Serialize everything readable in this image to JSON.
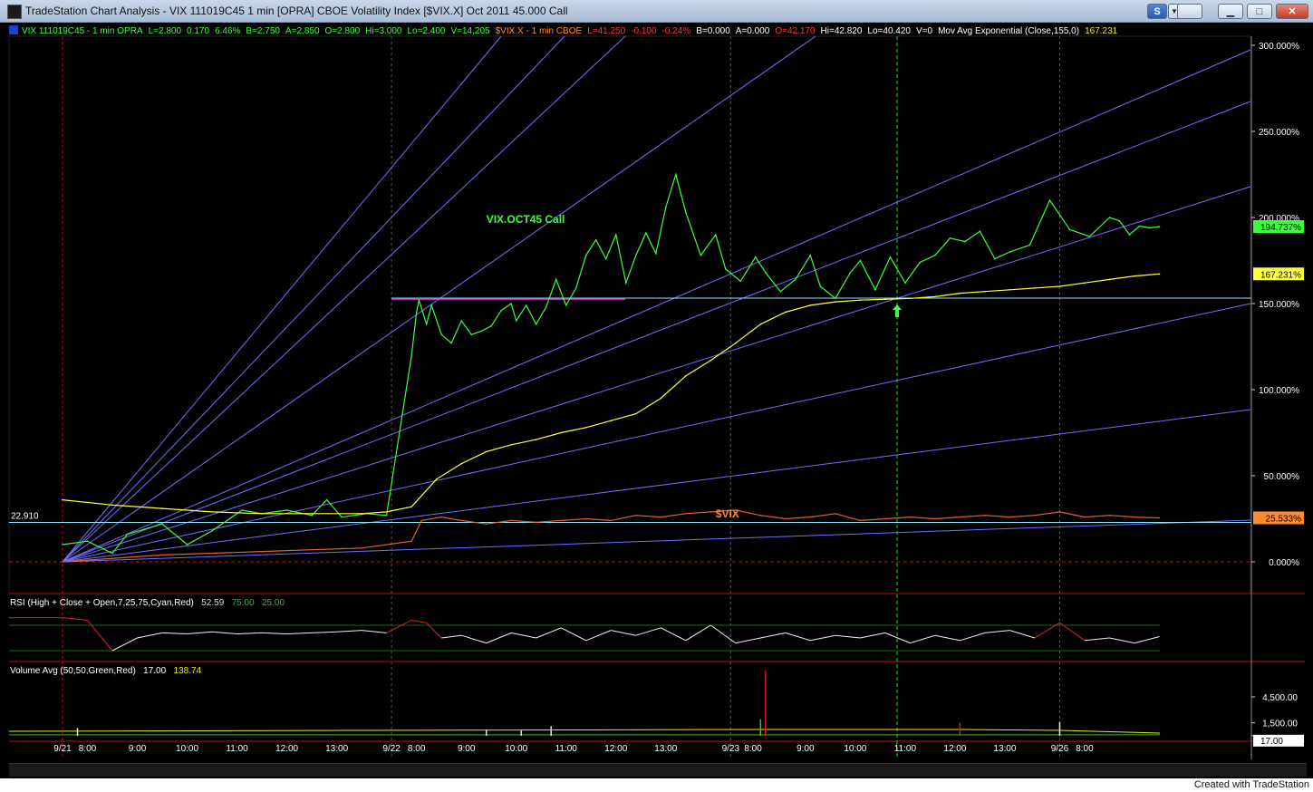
{
  "window": {
    "title": "TradeStation Chart Analysis - VIX 111019C45 1 min [OPRA] CBOE Volatility Index [$VIX.X] Oct 2011 45.000 Call",
    "btn_s": "S",
    "btn_pin": "▼",
    "btn_min": "▁",
    "btn_max": "□",
    "btn_close": "✕"
  },
  "footer": {
    "text": "Created with TradeStation"
  },
  "header": {
    "sym1": "VIX 111019C45 - 1 min  OPRA",
    "sym1_last": "L=2.800",
    "sym1_chg": "0.170",
    "sym1_pct": "6.46%",
    "sym1_bid": "B=2.750",
    "sym1_ask": "A=2.850",
    "sym1_open": "O=2.800",
    "sym1_hi": "Hi=3.000",
    "sym1_lo": "Lo=2.400",
    "sym1_vol": "V=14,205",
    "sym2": "$VIX.X - 1 min  CBOE",
    "sym2_last": "L=41.250",
    "sym2_chg": "-0.100",
    "sym2_pct": "-0.24%",
    "sym2_bid": "B=0.000",
    "sym2_ask": "A=0.000",
    "sym2_open": "O=42.170",
    "sym2_hi": "Hi=42.820",
    "sym2_lo": "Lo=40.420",
    "sym2_vol": "V=0",
    "ma_label": "Mov Avg Exponential (Close,155,0)",
    "ma_value": "167.231"
  },
  "rsi_header": {
    "label": "RSI (High + Close + Open,7,25,75,Cyan,Red)",
    "value": "52.59",
    "ob": "75.00",
    "os": "25.00"
  },
  "vol_header": {
    "label": "Volume Avg (50,50,Green,Red)",
    "value": "17.00",
    "avg": "138.74"
  },
  "colors": {
    "option_line": "#3cff3c",
    "vix_line": "#e0622a",
    "ma_line": "#ffff3c",
    "gann_line": "#6f6fff",
    "cyan_line": "#8fe8ff",
    "magenta_line": "#e040e0",
    "grid_green": "#0a6f0a",
    "session_red": "#c01010",
    "axis_text": "#ffffff",
    "header_green": "#3cff3c",
    "header_red": "#ff3a3a",
    "header_orange": "#ff8a30",
    "header_yellow": "#e8e830"
  },
  "chart_data": {
    "type": "line",
    "title": "",
    "x_tick_labels": [
      "9/21",
      "8:00",
      "9:00",
      "10:00",
      "11:00",
      "12:00",
      "13:00",
      "9/22",
      "8:00",
      "9:00",
      "10:00",
      "11:00",
      "12:00",
      "13:00",
      "9/23",
      "8:00",
      "9:00",
      "10:00",
      "11:00",
      "12:00",
      "13:00",
      "9/26",
      "8:00"
    ],
    "y_tick_labels": [
      "300.000%",
      "250.000%",
      "200.000%",
      "150.000%",
      "100.000%",
      "50.000%",
      "0.000%"
    ],
    "y_ticks": [
      300,
      250,
      200,
      150,
      100,
      50,
      0
    ],
    "ylim": [
      -14,
      314
    ],
    "ylabel": "",
    "last_value_tags": [
      {
        "label": "194.737%",
        "value": 194.737,
        "series": "VIX OCT45 Call"
      },
      {
        "label": "167.231%",
        "value": 167.231,
        "series": "Mov Avg Exponential"
      },
      {
        "label": "25.533%",
        "value": 25.533,
        "series": "$VIX"
      }
    ],
    "reference_level": {
      "label": "22.910",
      "value": 22.9
    },
    "annotations": [
      {
        "text": "VIX.OCT45 Call",
        "x": 8.5,
        "y": 199
      },
      {
        "text": "$VIX",
        "x": 13.1,
        "y": 28
      }
    ],
    "series": [
      {
        "name": "VIX.OCT45 Call",
        "x": [
          0,
          0.5,
          1,
          1.3,
          2,
          2.5,
          3,
          3.3,
          3.6,
          4,
          4.5,
          5,
          5.3,
          5.6,
          6.1,
          6.5,
          7,
          7.1,
          7.15,
          7.3,
          7.4,
          7.6,
          7.8,
          8,
          8.2,
          8.4,
          8.6,
          8.8,
          9,
          9.1,
          9.3,
          9.5,
          9.7,
          9.9,
          10.1,
          10.3,
          10.5,
          10.7,
          10.9,
          11.1,
          11.3,
          11.5,
          11.7,
          11.9,
          12.1,
          12.3,
          12.5,
          12.8,
          13.1,
          13.3,
          13.6,
          13.9,
          14.1,
          14.4,
          14.7,
          15,
          15.2,
          15.5,
          15.8,
          16,
          16.3,
          16.6,
          16.9,
          17.2,
          17.5,
          17.8,
          18.1,
          18.4,
          18.7,
          19,
          19.4,
          19.8,
          20.2,
          20.6,
          21,
          21.2,
          21.4,
          21.6,
          21.8,
          22
        ],
        "y": [
          10,
          12,
          5,
          16,
          22,
          10,
          18,
          24,
          30,
          28,
          30,
          27,
          36,
          26,
          28,
          27,
          120,
          145,
          152,
          138,
          149,
          132,
          127,
          140,
          132,
          134,
          137,
          146,
          150,
          140,
          149,
          138,
          148,
          164,
          149,
          159,
          178,
          187,
          176,
          190,
          162,
          178,
          191,
          179,
          206,
          225,
          203,
          178,
          190,
          170,
          163,
          177,
          168,
          157,
          164,
          178,
          160,
          153,
          168,
          175,
          158,
          177,
          162,
          174,
          178,
          188,
          186,
          192,
          176,
          180,
          184,
          210,
          193,
          189,
          200,
          198,
          190,
          195,
          194,
          194.7
        ]
      },
      {
        "name": "$VIX",
        "x": [
          0,
          1,
          2,
          3,
          4,
          5,
          6,
          7,
          7.2,
          7.6,
          8,
          8.5,
          9,
          9.5,
          10,
          10.5,
          11,
          11.5,
          12,
          12.5,
          13,
          13.5,
          14,
          14.5,
          15,
          15.5,
          16,
          16.5,
          17,
          17.5,
          18,
          18.5,
          19,
          19.5,
          20,
          20.5,
          21,
          21.5,
          22
        ],
        "y": [
          0,
          2,
          4,
          5,
          6,
          7,
          8,
          12,
          24,
          26,
          24,
          22,
          24,
          23,
          24,
          25,
          24,
          27,
          26,
          28,
          29,
          30,
          27,
          25,
          26,
          28,
          24,
          25,
          26,
          25,
          26,
          27,
          26,
          27,
          29,
          26,
          27,
          26,
          25.5
        ]
      },
      {
        "name": "Mov Avg Exponential",
        "x": [
          0,
          1,
          2,
          3,
          4,
          5,
          6,
          6.5,
          7,
          7.5,
          8,
          8.5,
          9,
          9.5,
          10,
          10.5,
          11,
          11.5,
          12,
          12.5,
          13,
          13.5,
          14,
          14.5,
          15,
          15.5,
          16,
          16.5,
          17,
          17.5,
          18,
          18.5,
          19,
          19.5,
          20,
          20.5,
          21,
          21.5,
          22
        ],
        "y": [
          36,
          33,
          31,
          29,
          28,
          28,
          28,
          29,
          32,
          48,
          57,
          64,
          68,
          71,
          75,
          78,
          82,
          86,
          95,
          108,
          117,
          127,
          138,
          145,
          149,
          151,
          152,
          152.5,
          153,
          154,
          156,
          157,
          158,
          159,
          160,
          162,
          164,
          166,
          167.2
        ]
      }
    ],
    "rsi": {
      "overbought": 75,
      "oversold": 25,
      "ylim": [
        0,
        100
      ],
      "x": [
        0,
        0.5,
        1,
        1.5,
        2,
        2.5,
        3,
        3.5,
        4,
        4.5,
        5,
        5.5,
        6,
        6.5,
        7,
        7.3,
        7.6,
        8,
        8.5,
        9,
        9.5,
        10,
        10.5,
        11,
        11.5,
        12,
        12.5,
        13,
        13.5,
        14,
        14.5,
        15,
        15.5,
        16,
        16.5,
        17,
        17.5,
        18,
        18.5,
        19,
        19.5,
        20,
        20.5,
        21,
        21.5,
        22
      ],
      "y": [
        90,
        85,
        25,
        50,
        60,
        58,
        62,
        58,
        60,
        58,
        60,
        62,
        65,
        60,
        85,
        80,
        50,
        55,
        40,
        60,
        50,
        70,
        45,
        65,
        55,
        70,
        45,
        75,
        40,
        50,
        60,
        45,
        55,
        50,
        60,
        40,
        55,
        45,
        60,
        65,
        50,
        80,
        45,
        50,
        40,
        52.6
      ]
    },
    "volume": {
      "y_tick_labels": [
        "4,500.00",
        "1,500.00",
        "17.00"
      ],
      "y_ticks": [
        4500,
        1500,
        17
      ],
      "ylim": [
        0,
        8000
      ],
      "spikes": [
        {
          "x": 14.1,
          "value": 7500,
          "color": "red"
        },
        {
          "x": 14.0,
          "value": 1900,
          "color": "green"
        },
        {
          "x": 18.0,
          "value": 1500,
          "color": "red"
        },
        {
          "x": 20.0,
          "value": 1600,
          "color": "white"
        },
        {
          "x": 8.5,
          "value": 700,
          "color": "white"
        },
        {
          "x": 9.2,
          "value": 600,
          "color": "white"
        },
        {
          "x": 9.8,
          "value": 1100,
          "color": "white"
        },
        {
          "x": 0.3,
          "value": 900,
          "color": "white"
        }
      ]
    }
  }
}
